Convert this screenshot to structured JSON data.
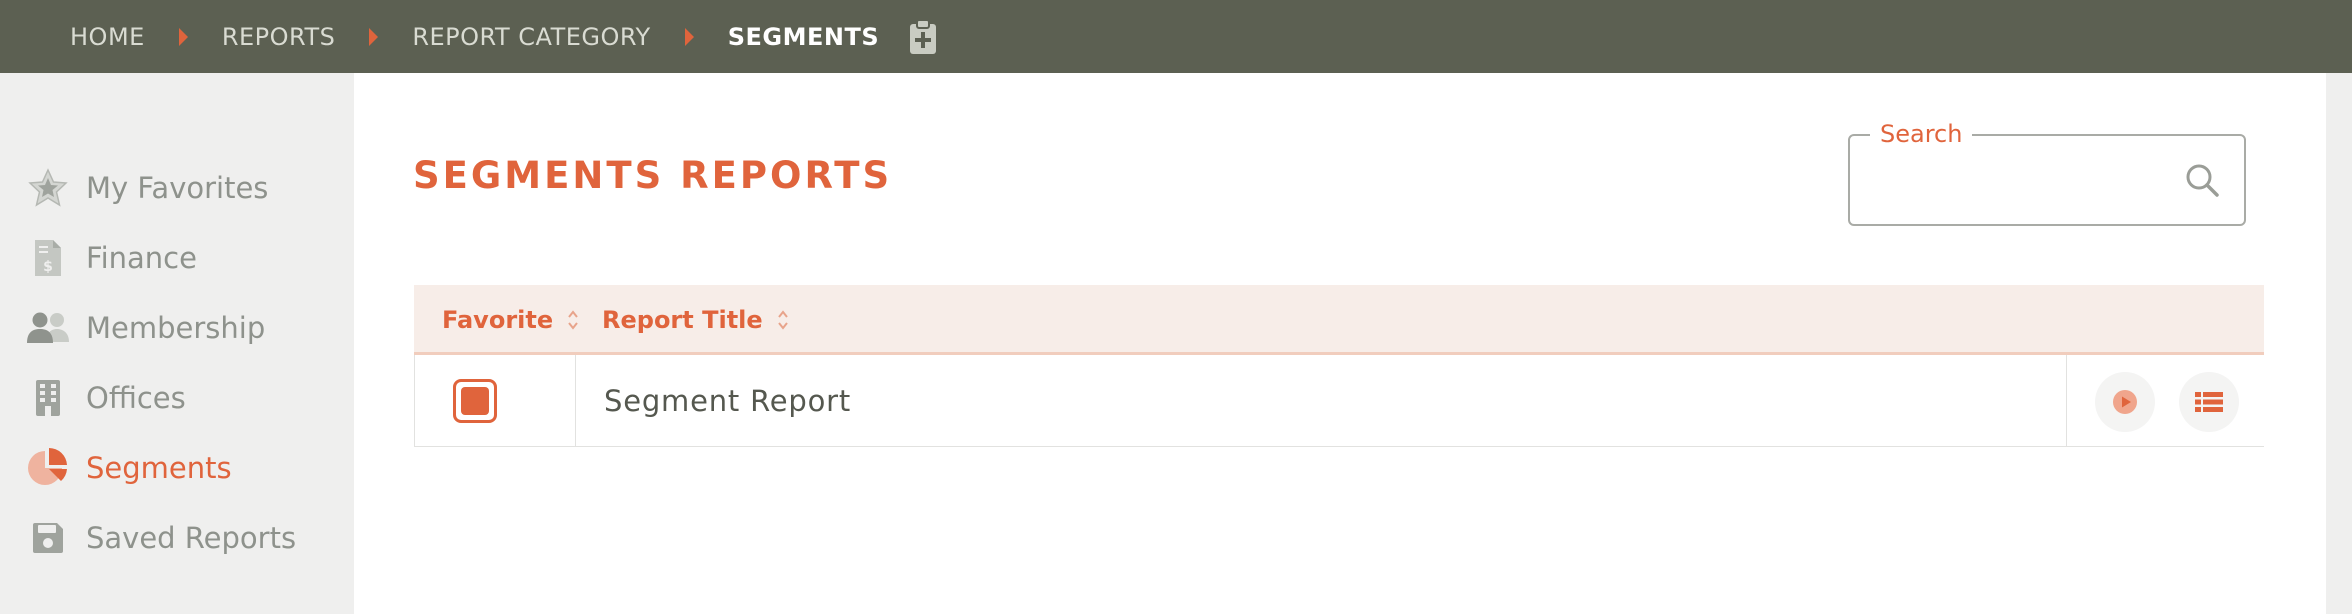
{
  "breadcrumb": {
    "items": [
      {
        "label": "HOME"
      },
      {
        "label": "REPORTS"
      },
      {
        "label": "REPORT CATEGORY"
      },
      {
        "label": "SEGMENTS"
      }
    ]
  },
  "sidebar": {
    "items": [
      {
        "label": "My Favorites",
        "icon": "star-icon"
      },
      {
        "label": "Finance",
        "icon": "invoice-icon"
      },
      {
        "label": "Membership",
        "icon": "users-icon"
      },
      {
        "label": "Offices",
        "icon": "building-icon"
      },
      {
        "label": "Segments",
        "icon": "pie-chart-icon",
        "active": true
      },
      {
        "label": "Saved Reports",
        "icon": "floppy-disk-icon"
      }
    ]
  },
  "main": {
    "title": "SEGMENTS REPORTS",
    "search": {
      "label": "Search",
      "value": ""
    },
    "table": {
      "columns": [
        {
          "label": "Favorite"
        },
        {
          "label": "Report Title"
        }
      ],
      "rows": [
        {
          "favorite": true,
          "title": "Segment Report"
        }
      ]
    }
  },
  "colors": {
    "accent": "#e0643c",
    "topbar": "#5c6052",
    "sidebar_bg": "#efefee",
    "table_header_bg": "#f7ede8",
    "muted_text": "#8e928c"
  }
}
